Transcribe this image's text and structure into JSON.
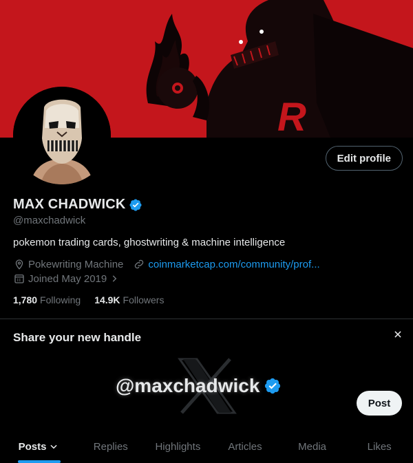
{
  "profile": {
    "name": "MAX CHADWICK",
    "handle": "@maxchadwick",
    "bio": "pokemon trading cards, ghostwriting & machine intelligence",
    "location": "Pokewriting Machine",
    "website": "coinmarketcap.com/community/prof...",
    "joined": "Joined May 2019",
    "following_count": "1,780",
    "following_label": "Following",
    "followers_count": "14.9K",
    "followers_label": "Followers",
    "edit_label": "Edit profile",
    "verified_icon": "verified-badge-icon"
  },
  "share": {
    "title": "Share your new handle",
    "handle": "@maxchadwick",
    "post_label": "Post"
  },
  "tabs": [
    {
      "label": "Posts",
      "active": true
    },
    {
      "label": "Replies"
    },
    {
      "label": "Highlights"
    },
    {
      "label": "Articles"
    },
    {
      "label": "Media"
    },
    {
      "label": "Likes"
    }
  ],
  "colors": {
    "accent": "#1d9bf0",
    "banner": "#c4161c",
    "background": "#000000",
    "muted": "#71767b"
  }
}
